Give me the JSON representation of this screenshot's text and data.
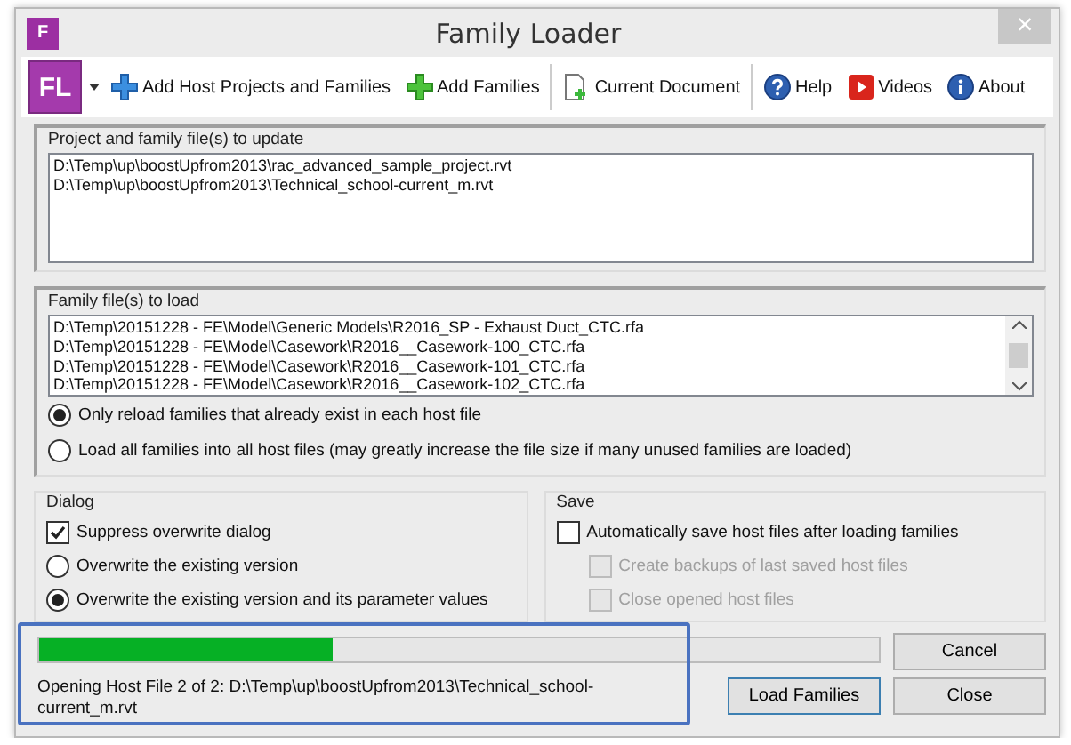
{
  "window": {
    "title": "Family Loader",
    "logo": "F",
    "close": "×"
  },
  "toolbar": {
    "logo": "FL",
    "items": [
      {
        "kind": "host",
        "label": "Add Host Projects and Families"
      },
      {
        "kind": "add",
        "label": "Add Families"
      },
      {
        "kind": "separator"
      },
      {
        "kind": "document",
        "label": "Current Document"
      },
      {
        "kind": "separator"
      },
      {
        "kind": "help",
        "label": "Help"
      },
      {
        "kind": "video",
        "label": "Videos"
      },
      {
        "kind": "about",
        "label": "About"
      }
    ]
  },
  "projects": {
    "title": "Project and family file(s) to update",
    "files": [
      "D:\\Temp\\up\\boostUpfrom2013\\rac_advanced_sample_project.rvt",
      "D:\\Temp\\up\\boostUpfrom2013\\Technical_school-current_m.rvt"
    ]
  },
  "families": {
    "title": "Family file(s) to load",
    "files": [
      "D:\\Temp\\20151228 - FE\\Model\\Generic Models\\R2016_SP - Exhaust Duct_CTC.rfa",
      "D:\\Temp\\20151228 - FE\\Model\\Casework\\R2016__Casework-100_CTC.rfa",
      "D:\\Temp\\20151228 - FE\\Model\\Casework\\R2016__Casework-101_CTC.rfa",
      "D:\\Temp\\20151228 - FE\\Model\\Casework\\R2016__Casework-102_CTC.rfa"
    ],
    "options": [
      {
        "label": "Only reload families that already exist in each host file",
        "selected": true
      },
      {
        "label": "Load all families into all host files (may greatly increase the file size if many unused families are loaded)",
        "selected": false
      }
    ]
  },
  "dialog": {
    "title": "Dialog",
    "options": [
      {
        "kind": "checkbox",
        "label": "Suppress overwrite dialog",
        "checked": true
      },
      {
        "kind": "radio",
        "label": "Overwrite the existing version",
        "selected": false
      },
      {
        "kind": "radio",
        "label": "Overwrite the existing version and its parameter values",
        "selected": true
      }
    ]
  },
  "save": {
    "title": "Save",
    "options": [
      {
        "label": "Automatically save host files after loading families",
        "checked": false,
        "disabled": false,
        "indent": false
      },
      {
        "label": "Create backups of last saved host files",
        "checked": false,
        "disabled": true,
        "indent": true
      },
      {
        "label": "Close opened host files",
        "checked": false,
        "disabled": true,
        "indent": true
      }
    ]
  },
  "progress": {
    "level": 0.35,
    "status": "Opening Host File 2 of 2: D:\\Temp\\up\\boostUpfrom2013\\Technical_school-current_m.rvt",
    "highlighted": true
  },
  "buttons": [
    {
      "label": "Cancel",
      "default": false
    },
    {
      "label": "Load Families",
      "default": true
    },
    {
      "label": "Close",
      "default": false
    }
  ]
}
